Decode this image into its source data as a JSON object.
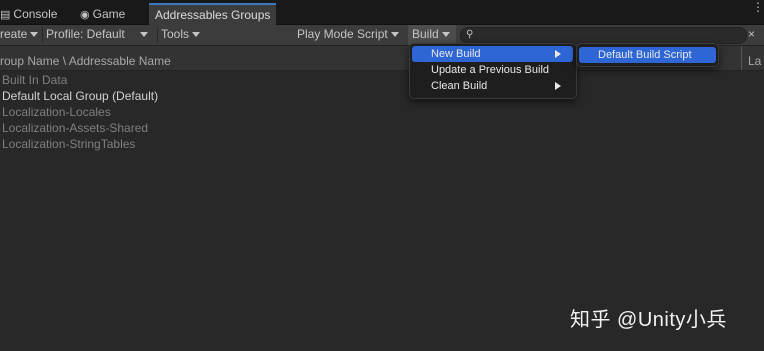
{
  "tabs": [
    {
      "label": "Console",
      "icon": "console-icon"
    },
    {
      "label": "Game",
      "icon": "gamepad-icon"
    },
    {
      "label": "Addressables Groups",
      "active": true
    }
  ],
  "toolbar": {
    "create": "reate",
    "profile": "Profile: Default",
    "tools": "Tools",
    "play_mode": "Play Mode Script",
    "build": "Build"
  },
  "header": {
    "col1": "roup Name \\ Addressable Name",
    "col2": "La"
  },
  "groups": [
    {
      "name": "Built In Data"
    },
    {
      "name": "Default Local Group (Default)"
    },
    {
      "name": "Localization-Locales"
    },
    {
      "name": "Localization-Assets-Shared"
    },
    {
      "name": "Localization-StringTables"
    }
  ],
  "build_menu": {
    "items": [
      {
        "label": "New Build",
        "has_submenu": true,
        "selected": true
      },
      {
        "label": "Update a Previous Build",
        "has_submenu": false
      },
      {
        "label": "Clean Build",
        "has_submenu": true
      }
    ],
    "submenu_items": [
      {
        "label": "Default Build Script",
        "selected": true
      }
    ]
  },
  "watermark": "知乎 @Unity小兵",
  "colors": {
    "accent": "#2f66d6",
    "tab_underline": "#3a79bb",
    "background": "#282828"
  }
}
